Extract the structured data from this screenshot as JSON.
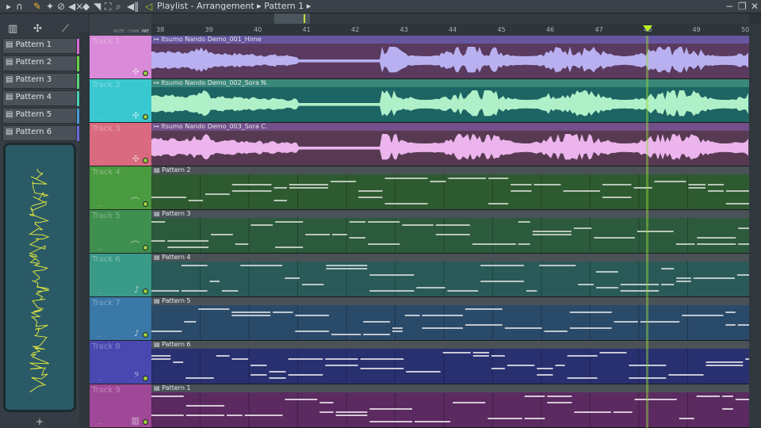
{
  "window": {
    "title": "Playlist - Arrangement",
    "breadcrumb": "Pattern 1",
    "minimize": "−",
    "restore": "❐",
    "close": "✕"
  },
  "toolbar_icons": [
    "menu-arrow-icon",
    "magnet-icon",
    "pencil-icon",
    "paint-icon",
    "delete-icon",
    "mute-icon",
    "slip-icon",
    "slice-icon",
    "select-icon",
    "zoom-icon",
    "playback-icon"
  ],
  "header_labels": {
    "note": "NOTE",
    "chan": "CHAN",
    "pat": "PAT"
  },
  "patterns": [
    {
      "label": "Pattern 1",
      "color": "#d86ad0"
    },
    {
      "label": "Pattern 2",
      "color": "#6ad04a"
    },
    {
      "label": "Pattern 3",
      "color": "#5ad078"
    },
    {
      "label": "Pattern 4",
      "color": "#4ad0b0"
    },
    {
      "label": "Pattern 5",
      "color": "#4a9ad8"
    },
    {
      "label": "Pattern 6",
      "color": "#6a6ad8"
    }
  ],
  "add_label": "+",
  "ruler": {
    "bars": [
      "38",
      "39",
      "40",
      "41",
      "42",
      "43",
      "44",
      "45",
      "46",
      "47",
      "48",
      "49",
      "50"
    ],
    "playhead_bar": 48.2
  },
  "tracks": [
    {
      "name": "Track 1",
      "color": "#d98ad9",
      "clip": "Itsumo Nando Demo_001_Hime",
      "type": "audio",
      "bg": "#5a3a5e",
      "hd": "#6656a0",
      "fg": "#b8b0f0",
      "icon": "✣"
    },
    {
      "name": "Track 2",
      "color": "#3ac8d0",
      "clip": "Itsumo Nando Demo_002_Sora N.",
      "type": "audio",
      "bg": "#1d6464",
      "hd": "#3a8878",
      "fg": "#b0f0c8",
      "icon": "✣"
    },
    {
      "name": "Track 3",
      "color": "#d96a80",
      "clip": "Itsumo Nando Demo_003_Sora C.",
      "type": "audio",
      "bg": "#573a52",
      "hd": "#74508a",
      "fg": "#ecb4ec",
      "icon": "✣"
    },
    {
      "name": "Track 4",
      "color": "#4a9a40",
      "clip": "Pattern 2",
      "type": "pattern",
      "bg": "#2e5a30",
      "hd": "#4a5258",
      "fg": "#b8c8b8",
      "icon": "⌒"
    },
    {
      "name": "Track 5",
      "color": "#3f9050",
      "clip": "Pattern 3",
      "type": "pattern",
      "bg": "#2c5a3c",
      "hd": "#4a5258",
      "fg": "#b8c8b8",
      "icon": "⌒"
    },
    {
      "name": "Track 6",
      "color": "#3a9a88",
      "clip": "Pattern 4",
      "type": "pattern",
      "bg": "#2a5a58",
      "hd": "#4a5258",
      "fg": "#b8c8c8",
      "icon": "♪"
    },
    {
      "name": "Track 7",
      "color": "#3a78a8",
      "clip": "Pattern 5",
      "type": "pattern",
      "bg": "#2a4a6a",
      "hd": "#4a5258",
      "fg": "#c0c8d0",
      "icon": "♪"
    },
    {
      "name": "Track 8",
      "color": "#4848b0",
      "clip": "Pattern 6",
      "type": "pattern",
      "bg": "#283070",
      "hd": "#4a5258",
      "fg": "#c8c8d8",
      "icon": "𝄢"
    },
    {
      "name": "Track 9",
      "color": "#a04898",
      "clip": "Pattern 1",
      "type": "pattern",
      "bg": "#5a2a60",
      "hd": "#4a5258",
      "fg": "#d8c8d8",
      "icon": "▥"
    }
  ]
}
